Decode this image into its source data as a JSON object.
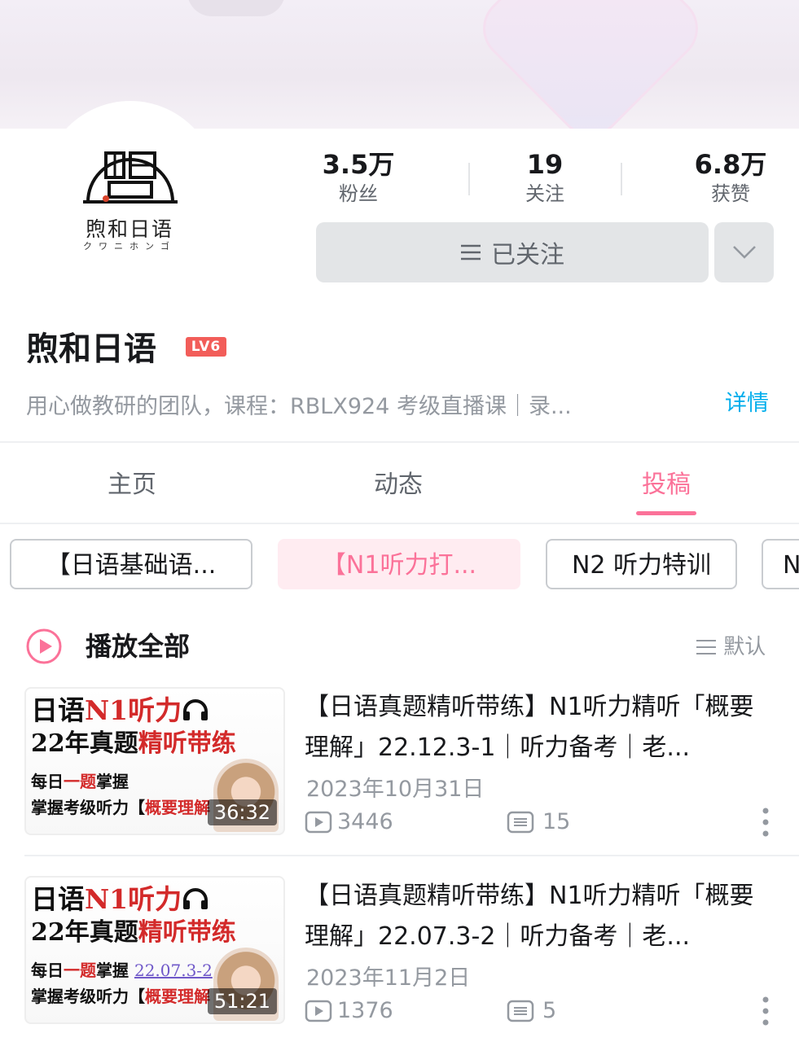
{
  "profile": {
    "avatar_name": "煦和日语",
    "avatar_sub": "クワニホンゴ",
    "stats": [
      {
        "num": "3.5万",
        "label": "粉丝"
      },
      {
        "num": "19",
        "label": "关注"
      },
      {
        "num": "6.8万",
        "label": "获赞"
      }
    ],
    "follow_label": "已关注",
    "username": "煦和日语",
    "level": "LV6",
    "bio": "用心做教研的团队，课程：RBLX924 考级直播课｜录...",
    "detail_label": "详情"
  },
  "tabs": [
    {
      "label": "主页",
      "active": false
    },
    {
      "label": "动态",
      "active": false
    },
    {
      "label": "投稿",
      "active": true
    }
  ],
  "chips": [
    {
      "label": "【日语基础语...",
      "active": false
    },
    {
      "label": "【N1听力打...",
      "active": true
    },
    {
      "label": "N2 听力特训",
      "active": false
    },
    {
      "label": "N",
      "active": false
    }
  ],
  "playlist": {
    "play_all_label": "播放全部",
    "sort_label": "默认"
  },
  "videos": [
    {
      "thumb_line1_a": "日语",
      "thumb_line1_b": "N1听力",
      "thumb_line2_a": "22年真题",
      "thumb_line2_b": "精听带练",
      "thumb_line3_a": "每日",
      "thumb_line3_b": "一题",
      "thumb_line3_c": "掌握",
      "thumb_line3_d": "",
      "thumb_line4_a": "掌握考级听力【",
      "thumb_line4_b": "概要理解",
      "duration": "36:32",
      "title": "【日语真题精听带练】N1听力精听「概要理解」22.12.3-1｜听力备考｜老...",
      "date": "2023年10月31日",
      "plays": "3446",
      "comments": "15"
    },
    {
      "thumb_line1_a": "日语",
      "thumb_line1_b": "N1听力",
      "thumb_line2_a": "22年真题",
      "thumb_line2_b": "精听带练",
      "thumb_line3_a": "每日",
      "thumb_line3_b": "一题",
      "thumb_line3_c": "掌握",
      "thumb_line3_d": "22.07.3-2",
      "thumb_line4_a": "掌握考级听力【",
      "thumb_line4_b": "概要理解",
      "duration": "51:21",
      "title": "【日语真题精听带练】N1听力精听「概要理解」22.07.3-2｜听力备考｜老...",
      "date": "2023年11月2日",
      "plays": "1376",
      "comments": "5"
    }
  ],
  "colors": {
    "accent": "#fb7299",
    "link": "#00aeec",
    "level_badge": "#f25d59"
  }
}
